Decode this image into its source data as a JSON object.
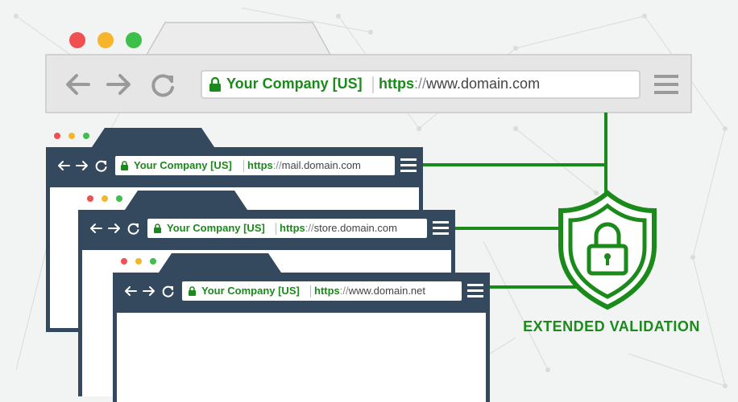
{
  "main_browser": {
    "company": "Your Company [US]",
    "scheme": "https",
    "separator": "://",
    "host": "www.domain.com"
  },
  "windows": [
    {
      "company": "Your Company [US]",
      "scheme": "https",
      "separator": "://",
      "host": "mail.domain.com"
    },
    {
      "company": "Your Company [US]",
      "scheme": "https",
      "separator": "://",
      "host": "store.domain.com"
    },
    {
      "company": "Your Company [US]",
      "scheme": "https",
      "separator": "://",
      "host": "www.domain.net"
    }
  ],
  "badge": {
    "label": "EXTENDED VALIDATION"
  },
  "colors": {
    "accent_green": "#1a8a1a",
    "window_frame": "#34495e",
    "dot_red": "#f0504f",
    "dot_yellow": "#f7b52b",
    "dot_green": "#3cc04a"
  },
  "icons": [
    "back-arrow-icon",
    "forward-arrow-icon",
    "reload-icon",
    "lock-icon",
    "menu-icon",
    "shield-lock-icon"
  ]
}
